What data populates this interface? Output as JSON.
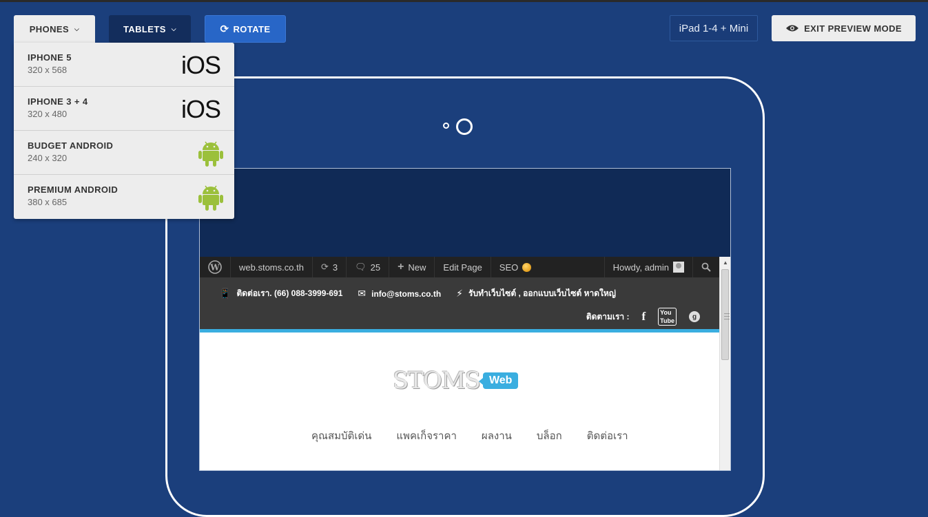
{
  "toolbar": {
    "phones_label": "PHONES",
    "tablets_label": "TABLETS",
    "rotate_label": "ROTATE",
    "device_label": "iPad 1-4 + Mini",
    "exit_label": "EXIT PREVIEW MODE"
  },
  "phones_menu": [
    {
      "name": "IPHONE 5",
      "size": "320 x 568",
      "os": "iOS"
    },
    {
      "name": "IPHONE 3 + 4",
      "size": "320 x 480",
      "os": "iOS"
    },
    {
      "name": "BUDGET ANDROID",
      "size": "240 x 320",
      "os": "android"
    },
    {
      "name": "PREMIUM ANDROID",
      "size": "380 x 685",
      "os": "android"
    }
  ],
  "wp_admin_bar": {
    "site": "web.stoms.co.th",
    "updates": "3",
    "comments": "25",
    "new": "New",
    "edit": "Edit Page",
    "seo": "SEO",
    "howdy": "Howdy, admin"
  },
  "site": {
    "phone": "ติดต่อเรา. (66) 088-3999-691",
    "email": "info@stoms.co.th",
    "tagline": "รับทำเว็บไซต์ , ออกแบบเว็บไซต์ หาดใหญ่",
    "follow": "ติดตามเรา :",
    "logo_text": "STOMS",
    "logo_badge": "Web",
    "nav": [
      "คุณสมบัติเด่น",
      "แพคเก็จราคา",
      "ผลงาน",
      "บล็อก",
      "ติดต่อเรา"
    ]
  },
  "colors": {
    "background": "#1b3f7c",
    "accent": "#3aaee0",
    "rotate": "#2866c7"
  }
}
